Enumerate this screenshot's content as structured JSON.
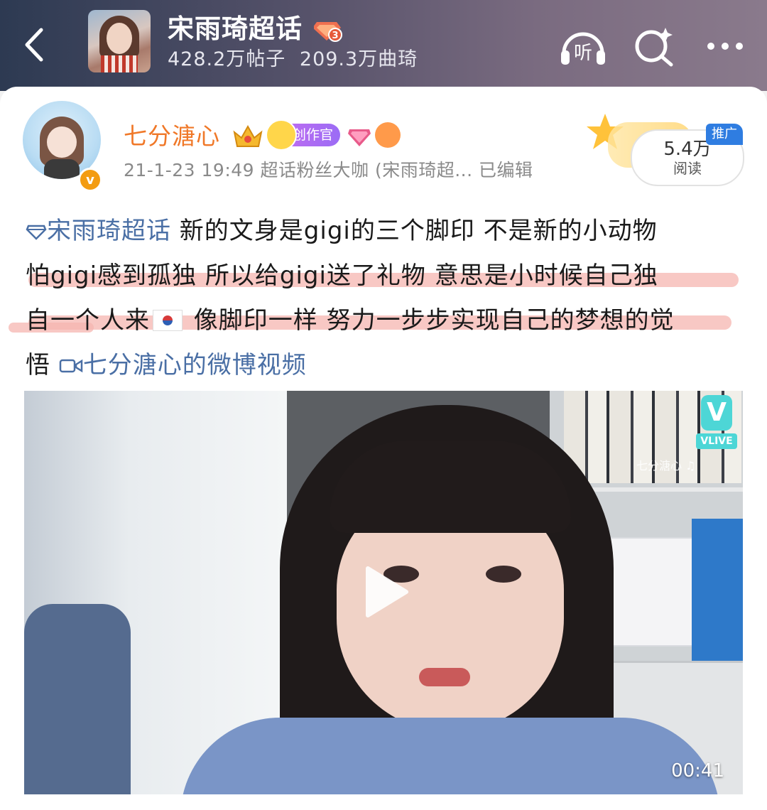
{
  "header": {
    "title": "宋雨琦超话",
    "level_badge": "3",
    "posts": "428.2万帖子",
    "followers": "209.3万曲琦",
    "listen_label": "听"
  },
  "post": {
    "username": "七分溏心",
    "creator_badge": "创作官",
    "meta": "21-1-23 19:49  超话粉丝大咖 (宋雨琦超...  已编辑",
    "promo": {
      "views": "5.4万",
      "views_label": "阅读",
      "tag": "推广"
    },
    "text": {
      "topic": "宋雨琦超话",
      "line1_rest": " 新的文身是gigi的三个脚印 不是新的小动物",
      "line2": "怕gigi感到孤独 所以给gigi送了礼物 意思是小时候自己独",
      "line3_a": "自一个人来",
      "line3_b": " 像脚印一样 努力一步步实现自己的梦想的觉",
      "line4": "悟 ",
      "video_link": "七分溏心的微博视频"
    },
    "video": {
      "duration": "00:41",
      "vlive": "VLIVE",
      "watermark": "七分溏心 ♫"
    }
  },
  "colors": {
    "link": "#4a6fa5",
    "username": "#f07828",
    "highlight": "#f6b6b0"
  },
  "icons": [
    "back-icon",
    "headphones-icon",
    "search-sparkle-icon",
    "more-icon",
    "diamond-icon",
    "video-camera-icon",
    "play-icon"
  ]
}
